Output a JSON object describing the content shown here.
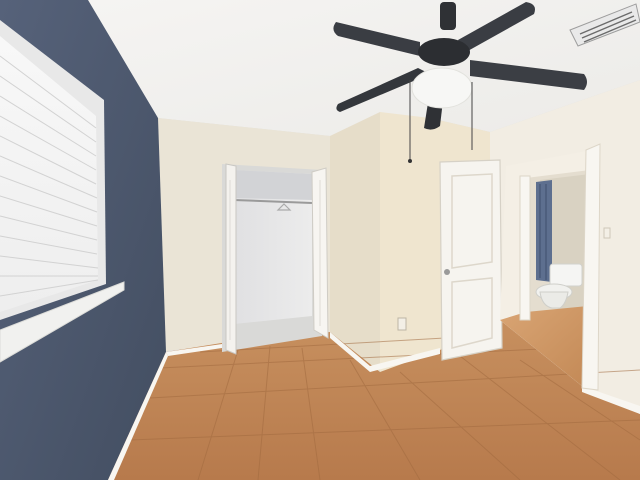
{
  "scene": {
    "description_colors": {
      "blue_wall": "#4d5a6e",
      "cream_wall": "#ede6d8",
      "ceiling": "#f3f1ee",
      "tile": "#c98f5e",
      "fan_dark": "#2f3135"
    },
    "objects": [
      "window-with-blinds",
      "open-closet",
      "ceiling-fan",
      "open-door",
      "bathroom-doorway",
      "toilet",
      "tile-floor",
      "outlet"
    ]
  }
}
